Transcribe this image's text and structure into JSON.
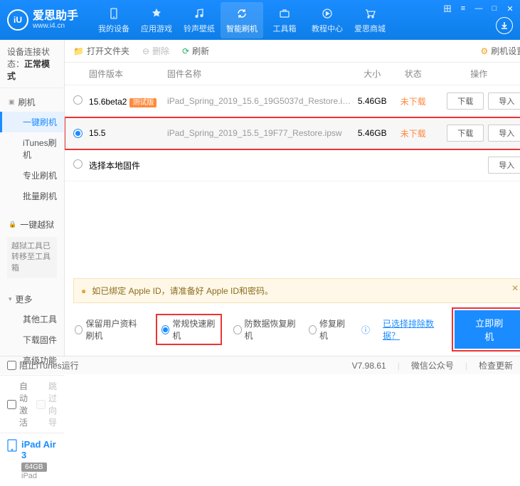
{
  "app": {
    "name_cn": "爱思助手",
    "url": "www.i4.cn",
    "logo_letter": "iU"
  },
  "winctrl": [
    "田",
    "≡",
    "—",
    "□",
    "✕"
  ],
  "nav": [
    {
      "label": "我的设备"
    },
    {
      "label": "应用游戏"
    },
    {
      "label": "铃声壁纸"
    },
    {
      "label": "智能刷机",
      "active": true
    },
    {
      "label": "工具箱"
    },
    {
      "label": "教程中心"
    },
    {
      "label": "爱思商城"
    }
  ],
  "sidebar": {
    "status_label": "设备连接状态：",
    "status_value": "正常模式",
    "sections": {
      "flash": {
        "head": "刷机",
        "items": [
          "一键刷机",
          "iTunes刷机",
          "专业刷机",
          "批量刷机"
        ],
        "active": 0
      },
      "jailbreak": {
        "head": "一键越狱",
        "notice": "越狱工具已转移至工具箱"
      },
      "more": {
        "head": "更多",
        "items": [
          "其他工具",
          "下载固件",
          "高级功能"
        ]
      }
    },
    "checks": {
      "auto_activate": "自动激活",
      "skip_guide": "跳过向导"
    },
    "device": {
      "name": "iPad Air 3",
      "capacity": "64GB",
      "model": "iPad"
    }
  },
  "toolbar": {
    "open": "打开文件夹",
    "delete": "删除",
    "refresh": "刷新",
    "settings": "刷机设置"
  },
  "table": {
    "headers": {
      "ver": "固件版本",
      "name": "固件名称",
      "size": "大小",
      "status": "状态",
      "ops": "操作"
    },
    "rows": [
      {
        "ver": "15.6beta2",
        "badge": "测试版",
        "name": "iPad_Spring_2019_15.6_19G5037d_Restore.i…",
        "size": "5.46GB",
        "status": "未下载",
        "selected": false
      },
      {
        "ver": "15.5",
        "badge": "",
        "name": "iPad_Spring_2019_15.5_19F77_Restore.ipsw",
        "size": "5.46GB",
        "status": "未下载",
        "selected": true
      }
    ],
    "local": "选择本地固件",
    "btn_dl": "下载",
    "btn_imp": "导入"
  },
  "warning": "如已绑定 Apple ID，请准备好 Apple ID和密码。",
  "options": {
    "keep": "保留用户资料刷机",
    "normal": "常规快速刷机",
    "recover": "防数据恢复刷机",
    "repair": "修复刷机",
    "exclude": "已选择排除数据？",
    "go": "立即刷机"
  },
  "statusbar": {
    "block": "阻止iTunes运行",
    "version": "V7.98.61",
    "wechat": "微信公众号",
    "update": "检查更新"
  }
}
